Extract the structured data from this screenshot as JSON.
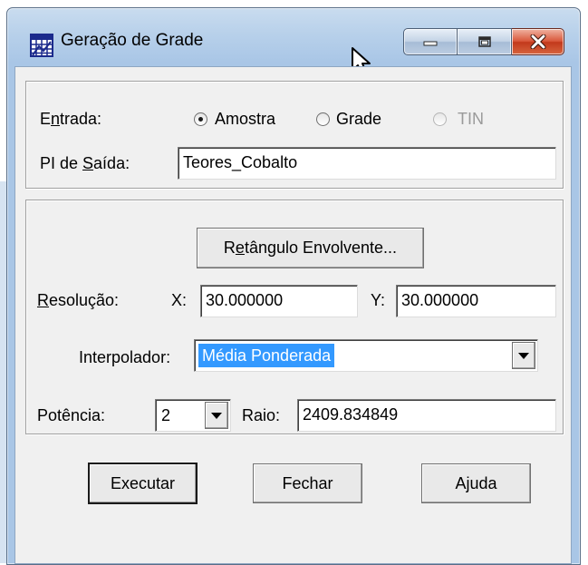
{
  "window": {
    "title": "Geração de Grade"
  },
  "input_section": {
    "entrada_label_u": "n",
    "entrada_label_pre": "E",
    "entrada_label_post": "trada:",
    "radios": [
      {
        "label": "Amostra",
        "checked": true,
        "enabled": true
      },
      {
        "label": "Grade",
        "checked": false,
        "enabled": true
      },
      {
        "label": "TIN",
        "checked": false,
        "enabled": false
      }
    ],
    "pi_label_pre": "PI de ",
    "pi_label_u": "S",
    "pi_label_post": "aída:",
    "pi_value": "Teores_Cobalto"
  },
  "grid_section": {
    "bbox_button_pre": "R",
    "bbox_button_u": "e",
    "bbox_button_post": "tângulo Envolvente...",
    "resolucao_label_u": "R",
    "resolucao_label_post": "esolução:",
    "x_label": "X:",
    "x_value": "30.000000",
    "y_label": "Y:",
    "y_value": "30.000000",
    "interpolador_label": "Interpolador:",
    "interpolador_value": "Média Ponderada",
    "potencia_label": "Potência:",
    "potencia_value": "2",
    "raio_label": "Raio:",
    "raio_value": "2409.834849"
  },
  "buttons": {
    "executar": "Executar",
    "fechar": "Fechar",
    "ajuda": "Ajuda"
  },
  "colors": {
    "selection": "#3399ff",
    "dialog_bg": "#f0f0f0",
    "titlebar": "#b7d0ea",
    "close_button": "#c2391c"
  },
  "icons": {
    "app": "grid-table-icon",
    "minimize": "minimize-icon",
    "maximize": "maximize-icon",
    "close": "close-icon",
    "cursor": "mouse-pointer-icon",
    "dropdown": "chevron-down-icon"
  }
}
